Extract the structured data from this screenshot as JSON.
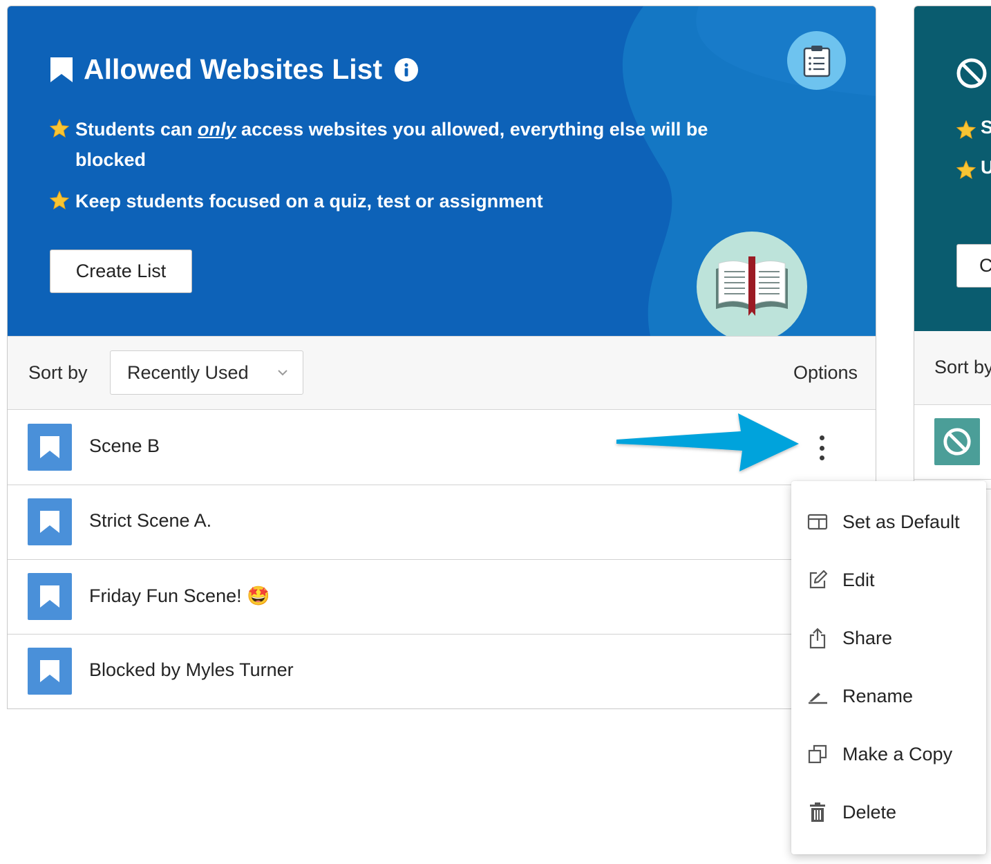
{
  "hero": {
    "title": "Allowed Websites List",
    "bullet1_prefix": "Students can ",
    "bullet1_emphasis": "only",
    "bullet1_suffix": " access websites you allowed, everything else will be blocked",
    "bullet2": "Keep students focused on a quiz, test or assignment",
    "create_button": "Create List"
  },
  "sort": {
    "label": "Sort by",
    "selected": "Recently Used",
    "options_label": "Options"
  },
  "lists": [
    {
      "name": "Scene B"
    },
    {
      "name": "Strict Scene A."
    },
    {
      "name": "Friday Fun Scene! 🤩"
    },
    {
      "name": "Blocked by Myles Turner"
    }
  ],
  "second_card": {
    "bullet1_fragment": "S",
    "bullet2_fragment": "U",
    "button_fragment": "C",
    "sort_fragment": "Sort by"
  },
  "menu": {
    "items": [
      {
        "label": "Set as Default",
        "icon": "default-window-icon"
      },
      {
        "label": "Edit",
        "icon": "edit-icon"
      },
      {
        "label": "Share",
        "icon": "share-icon"
      },
      {
        "label": "Rename",
        "icon": "rename-icon"
      },
      {
        "label": "Make a Copy",
        "icon": "copy-icon"
      },
      {
        "label": "Delete",
        "icon": "trash-icon"
      }
    ]
  },
  "colors": {
    "hero_blue": "#0d62b8",
    "hero_teal": "#0a5c6f",
    "tile_blue": "#4a90d9",
    "tile_teal": "#4b9e98",
    "arrow_cyan": "#00a3dc"
  }
}
